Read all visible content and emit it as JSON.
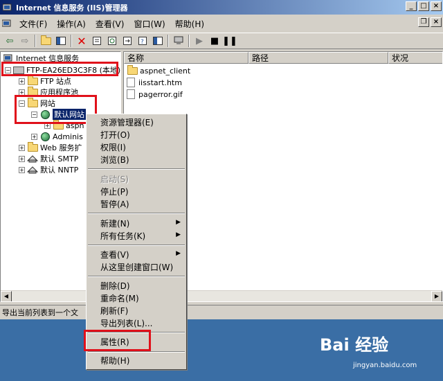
{
  "window": {
    "title": "Internet 信息服务 (IIS)管理器"
  },
  "menu": [
    "文件(F)",
    "操作(A)",
    "查看(V)",
    "窗口(W)",
    "帮助(H)"
  ],
  "tree": {
    "root": "Internet 信息服务",
    "server": "FTP-EA26ED3C3F8 (本地)",
    "ftp_sites": "FTP 站点",
    "app_pools": "应用程序池",
    "websites": "网站",
    "default_site": "默认网站",
    "aspnet_child": "aspn",
    "admin_site": "Adminis",
    "web_ext": "Web 服务扩",
    "smtp": "默认 SMTP",
    "nntp": "默认 NNTP"
  },
  "list": {
    "columns": [
      "名称",
      "路径",
      "状况"
    ],
    "items": [
      "aspnet_client",
      "iisstart.htm",
      "pagerror.gif"
    ]
  },
  "status": {
    "text": "导出当前列表到一个文"
  },
  "context_menu": {
    "explorer": "资源管理器(E)",
    "open": "打开(O)",
    "permissions": "权限(I)",
    "browse": "浏览(B)",
    "start": "启动(S)",
    "stop": "停止(P)",
    "pause": "暂停(A)",
    "new": "新建(N)",
    "all_tasks": "所有任务(K)",
    "view": "查看(V)",
    "new_window": "从这里创建窗口(W)",
    "delete": "删除(D)",
    "rename": "重命名(M)",
    "refresh": "刷新(F)",
    "export": "导出列表(L)...",
    "properties": "属性(R)",
    "help": "帮助(H)"
  },
  "watermark": {
    "logo": "Bai 经验",
    "url": "jingyan.baidu.com"
  },
  "colors": {
    "highlight_box": "#e0101a",
    "selection": "#0a246a",
    "desktop": "#3a6ea5"
  }
}
